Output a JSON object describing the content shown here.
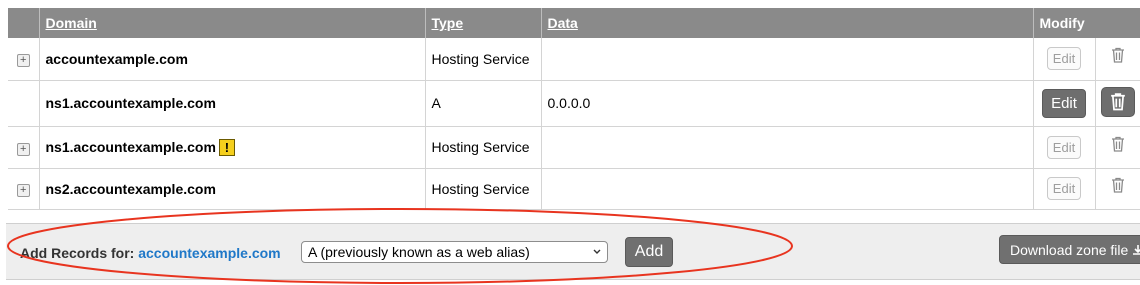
{
  "table": {
    "headers": {
      "domain": "Domain",
      "type": "Type",
      "data": "Data",
      "modify": "Modify"
    },
    "rows": [
      {
        "domain": "accountexample.com",
        "type": "Hosting Service",
        "data": "",
        "edit_label": "Edit",
        "expandable": true,
        "warning": false,
        "active": false
      },
      {
        "domain": "ns1.accountexample.com",
        "type": "A",
        "data": "0.0.0.0",
        "edit_label": "Edit",
        "expandable": false,
        "warning": false,
        "active": true
      },
      {
        "domain": "ns1.accountexample.com",
        "type": "Hosting Service",
        "data": "",
        "edit_label": "Edit",
        "expandable": true,
        "warning": true,
        "warning_symbol": "!",
        "active": false
      },
      {
        "domain": "ns2.accountexample.com",
        "type": "Hosting Service",
        "data": "",
        "edit_label": "Edit",
        "expandable": true,
        "warning": false,
        "active": false
      }
    ],
    "expand_symbol": "+"
  },
  "add_bar": {
    "label": "Add Records for:",
    "domain": "accountexample.com",
    "record_type_selected": "A (previously known as a web alias)",
    "add_label": "Add",
    "download_label": "Download zone file",
    "download_icon": "download-icon"
  },
  "annotation": {
    "color": "#e8341f",
    "shape": "ellipse"
  },
  "colors": {
    "header_bg": "#8a8a8a",
    "button_dark": "#707070",
    "link_blue": "#1f78c8",
    "warning_yellow": "#f5cf1d"
  }
}
